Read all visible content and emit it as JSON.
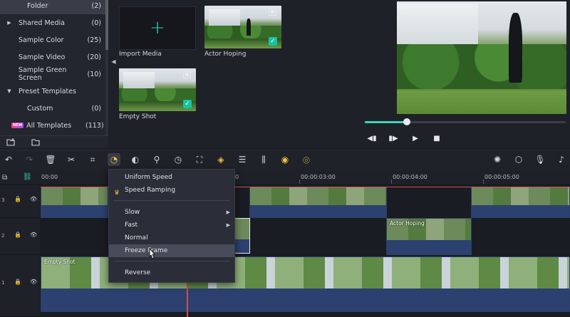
{
  "library": {
    "items": [
      {
        "label": "Folder",
        "count": "(2)",
        "arrow": "",
        "selected": true
      },
      {
        "label": "Shared Media",
        "count": "(0)",
        "arrow": "▶"
      },
      {
        "label": "Sample Color",
        "count": "(25)",
        "arrow": ""
      },
      {
        "label": "Sample Video",
        "count": "(20)",
        "arrow": ""
      },
      {
        "label": "Sample Green Screen",
        "count": "(10)",
        "arrow": ""
      },
      {
        "label": "Preset Templates",
        "count": "",
        "arrow": "▼"
      },
      {
        "label": "Custom",
        "count": "(0)",
        "arrow": ""
      },
      {
        "label": "All Templates",
        "count": "(113)",
        "arrow": "",
        "badge": "NEW"
      }
    ],
    "new_folder_icon": "new-folder-icon",
    "folder_icon": "folder-icon"
  },
  "media": {
    "import_label": "Import Media",
    "items": [
      {
        "label": "Actor Hoping"
      },
      {
        "label": "Empty Shot"
      }
    ]
  },
  "timeline": {
    "ticks": [
      "00:00",
      "00:00:03:00",
      "00:00:04:00",
      "00:00:05:00"
    ],
    "tracks": [
      {
        "num": "3"
      },
      {
        "num": "2"
      },
      {
        "num": "1"
      }
    ],
    "clips": {
      "actor_hoping": "Actor Hoping",
      "empty_shot": "Empty Shot"
    }
  },
  "context_menu": {
    "items": [
      "Uniform Speed",
      "Speed Ramping",
      "Slow",
      "Fast",
      "Normal",
      "Freeze Frame",
      "Reverse"
    ],
    "highlighted": "Freeze Frame"
  },
  "player": {
    "progress": 0.21
  },
  "colors": {
    "accent": "#2fd3b0",
    "playhead": "#e0484b",
    "clip": "#2a3f6a"
  }
}
